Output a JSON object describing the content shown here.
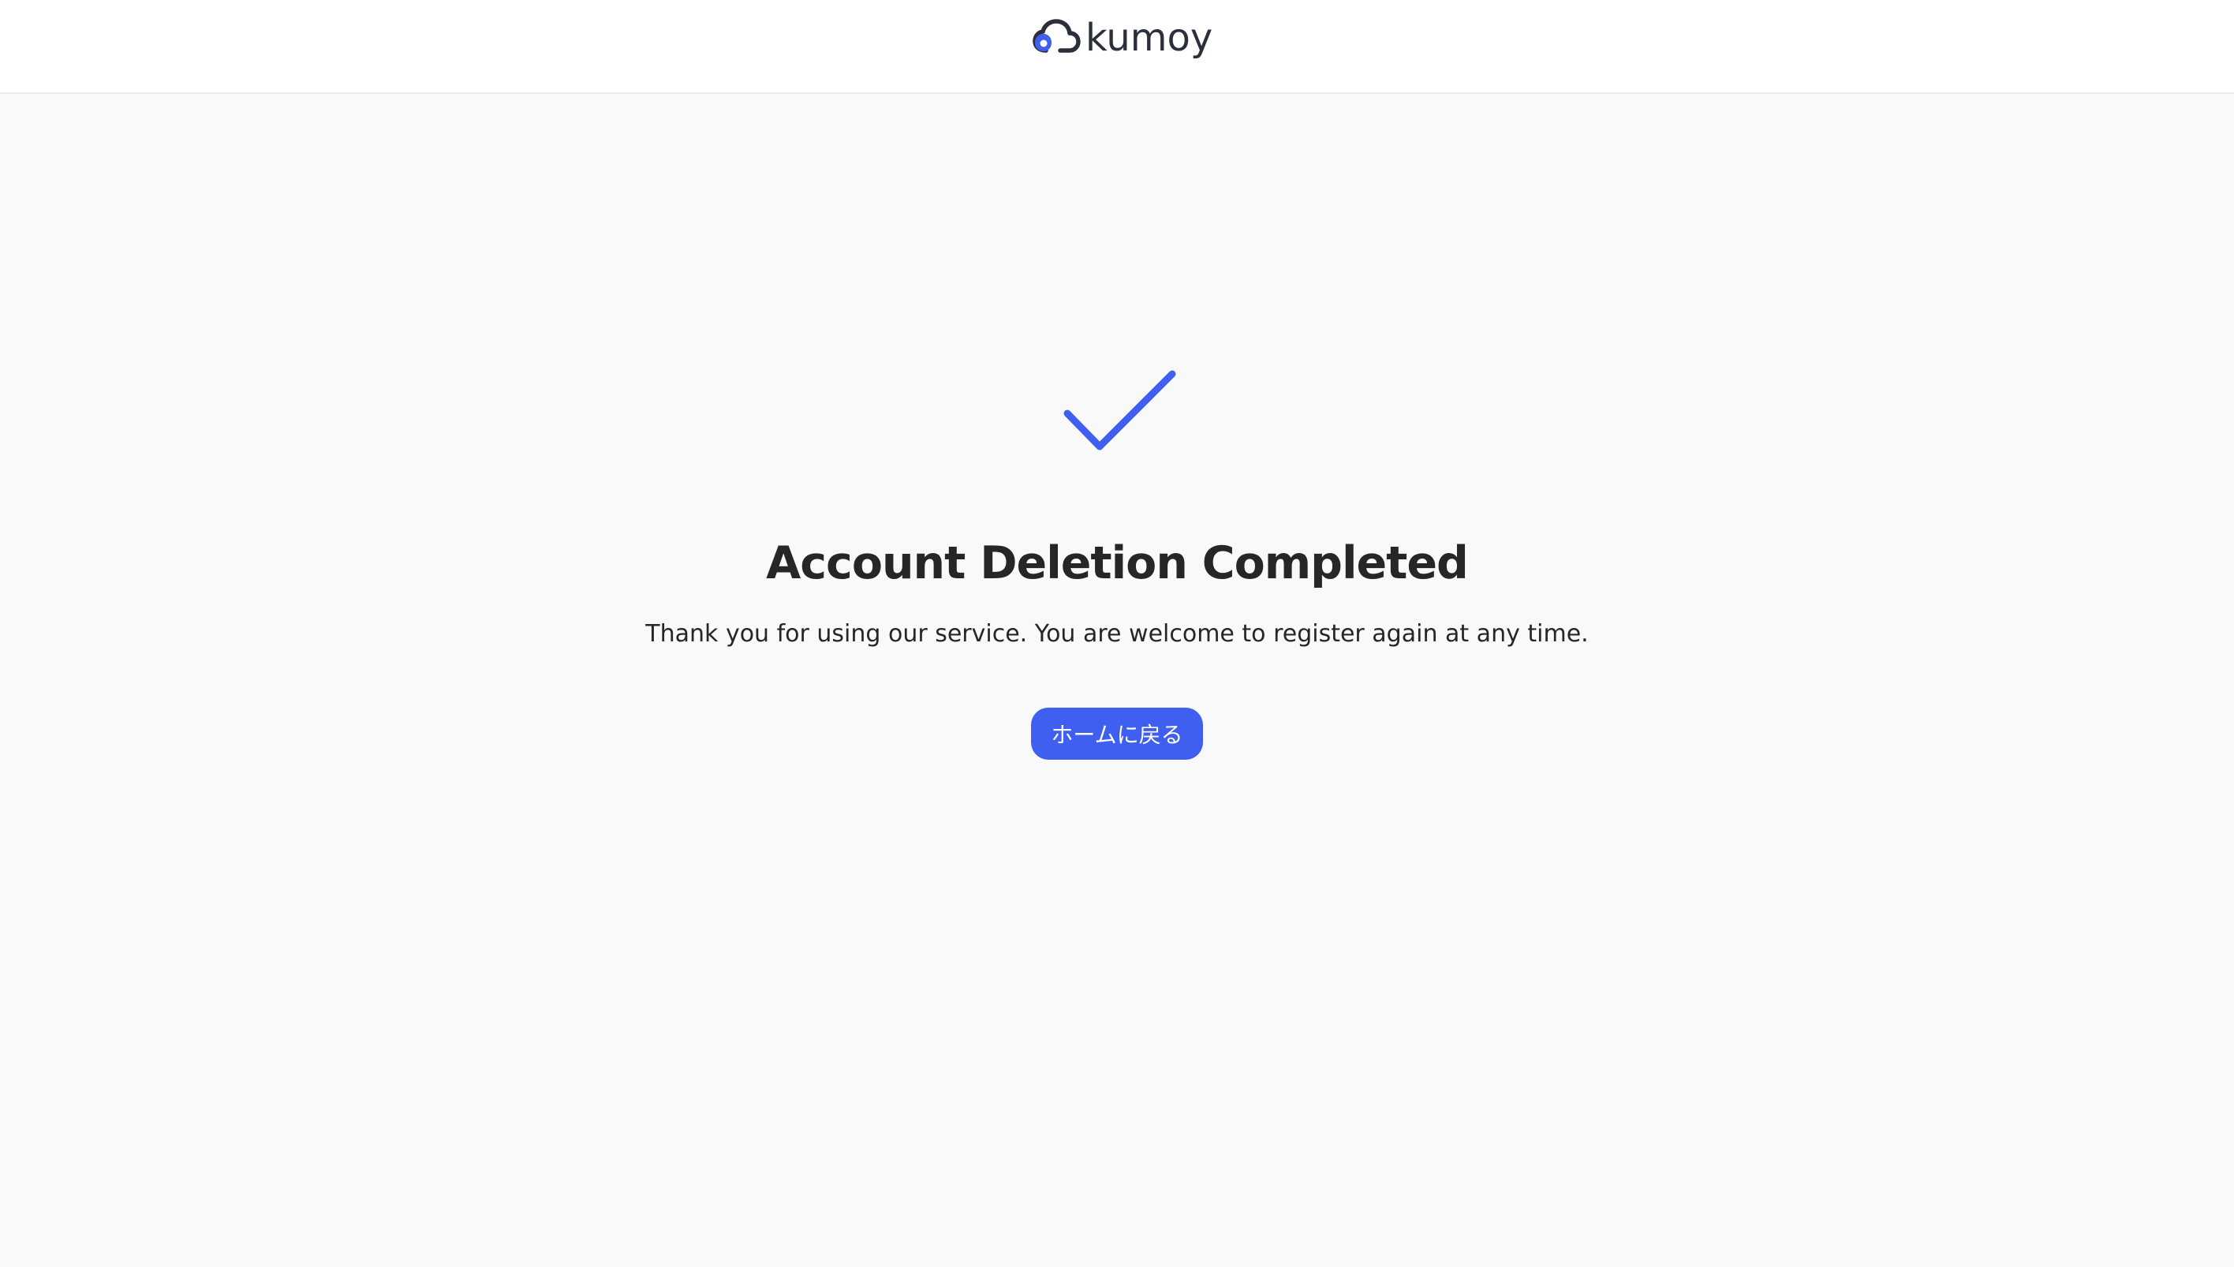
{
  "header": {
    "logo_text": "kumoy",
    "logo_icon": "cloud-logo-icon"
  },
  "main": {
    "status_icon": "checkmark-icon",
    "title": "Account Deletion Completed",
    "message": "Thank you for using our service. You are welcome to register again at any time.",
    "home_button_label": "ホームに戻る"
  },
  "colors": {
    "accent": "#3f5ff0",
    "background": "#f9f9f9",
    "header_background": "#ffffff",
    "text": "#262626"
  }
}
